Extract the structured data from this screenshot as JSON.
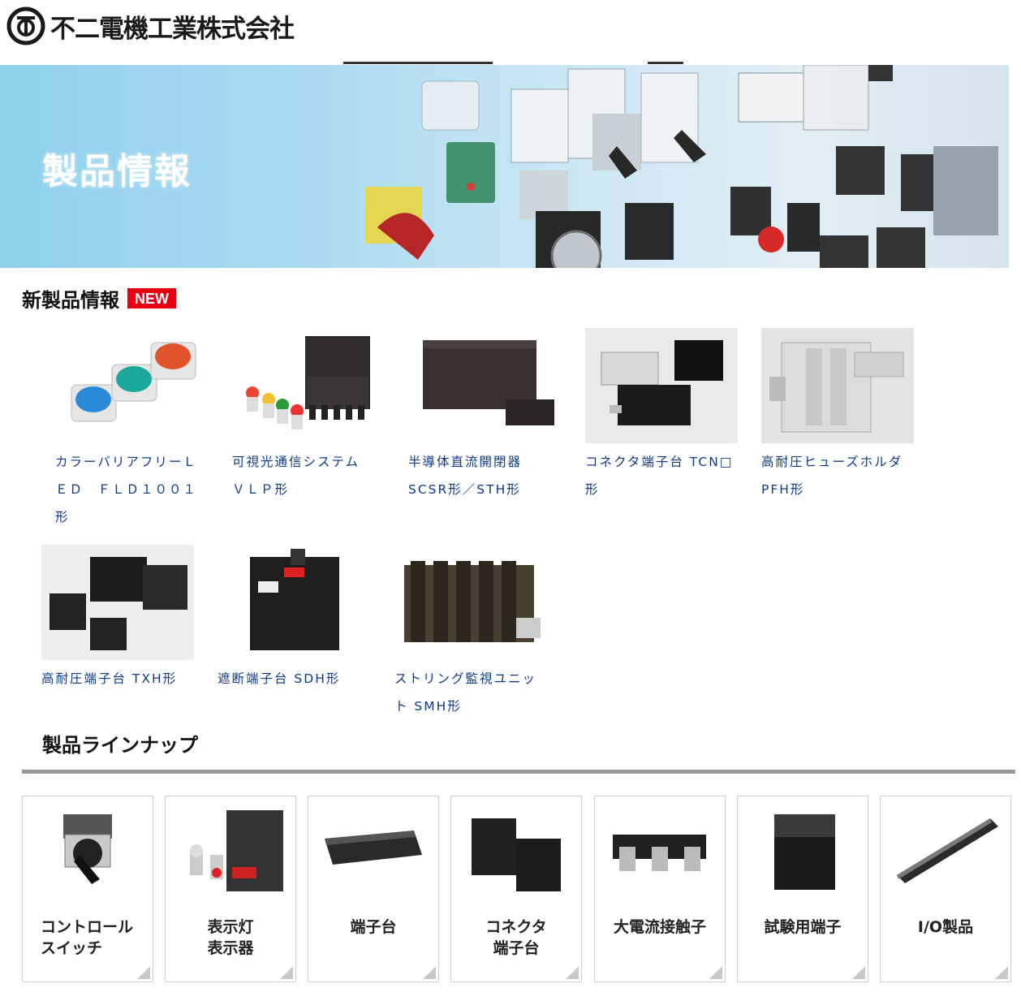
{
  "company": {
    "name": "不二電機工業株式会社"
  },
  "hero": {
    "title": "製品情報"
  },
  "new_products": {
    "heading": "新製品情報",
    "badge": "NEW",
    "items": [
      {
        "name": "カラーバリアフリーＬＥＤ　ＦＬＤ１００１形"
      },
      {
        "name": "可視光通信システム　ＶＬＰ形"
      },
      {
        "name": "半導体直流開閉器SCSR形／STH形"
      },
      {
        "name": "コネクタ端子台 TCN□形"
      },
      {
        "name": "高耐圧ヒューズホルダPFH形"
      },
      {
        "name": "高耐圧端子台 TXH形"
      },
      {
        "name": "遮断端子台 SDH形"
      },
      {
        "name": "ストリング監視ユニット SMH形"
      }
    ]
  },
  "lineup": {
    "heading": "製品ラインナップ",
    "cards": [
      {
        "label": "コントロール\nスイッチ"
      },
      {
        "label": "表示灯\n表示器"
      },
      {
        "label": "端子台"
      },
      {
        "label": "コネクタ\n端子台"
      },
      {
        "label": "大電流接触子"
      },
      {
        "label": "試験用端子"
      },
      {
        "label": "I/O製品"
      }
    ]
  },
  "colors": {
    "link": "#0f3b85",
    "badge": "#e60012",
    "rule": "#999999"
  }
}
